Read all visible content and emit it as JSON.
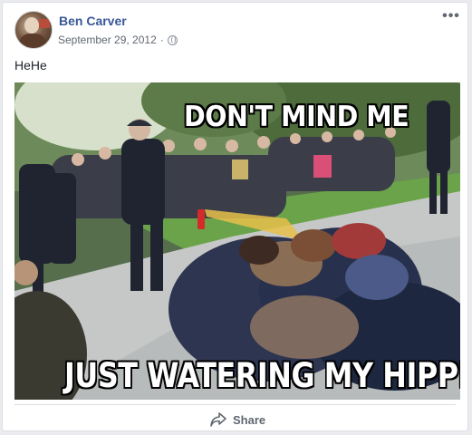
{
  "post": {
    "author": "Ben Carver",
    "date": "September 29, 2012",
    "separator": "·",
    "privacy_icon": "globe-icon",
    "more_icon": "more-options-icon",
    "more_glyph": "•••",
    "text": "HeHe"
  },
  "meme": {
    "top_text": "DON'T MIND ME",
    "bottom_text": "JUST WATERING MY HIPPIES"
  },
  "actions": {
    "share_label": "Share",
    "share_icon": "share-arrow-icon"
  },
  "colors": {
    "author_link": "#385898",
    "meta_text": "#616770",
    "background": "#e9ebee"
  }
}
